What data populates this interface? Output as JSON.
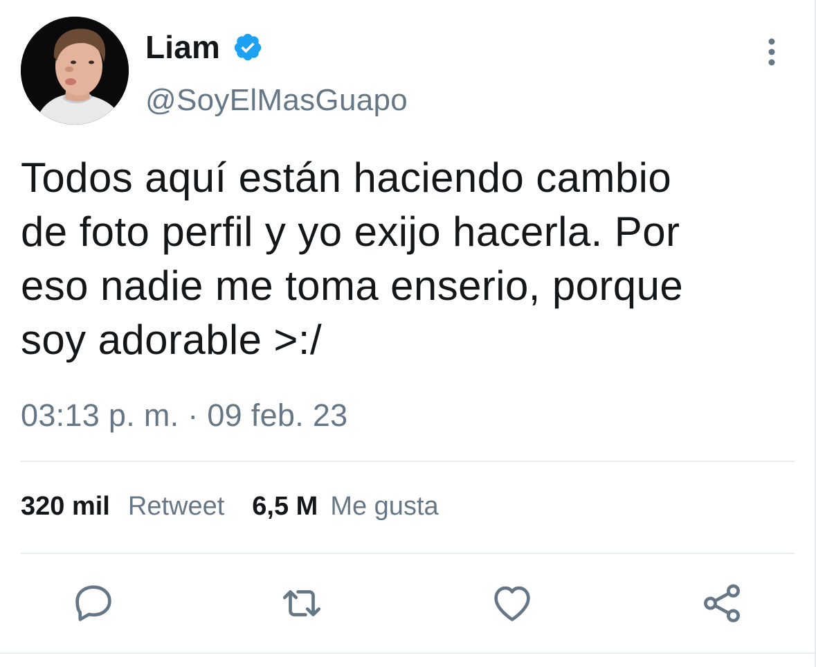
{
  "author": {
    "display_name": "Liam",
    "handle": "@SoyElMasGuapo",
    "verified": true
  },
  "tweet": {
    "text": "Todos aquí están haciendo cambio\nde foto perfil y yo exijo hacerla. Por\neso nadie me toma enserio, porque\nsoy adorable >:/",
    "timestamp": "03:13 p. m. · 09 feb. 23"
  },
  "stats": {
    "retweets_count": "320 mil",
    "retweets_label": "Retweet",
    "likes_count": "6,5 M",
    "likes_label": "Me gusta"
  },
  "icons": {
    "verified": "verified-badge-icon",
    "more": "more-options-icon",
    "reply": "reply-icon",
    "retweet": "retweet-icon",
    "like": "heart-icon",
    "share": "share-icon"
  },
  "colors": {
    "text": "#14171a",
    "secondary": "#657786",
    "verified": "#1da1f2",
    "divider": "#e6ecf0"
  }
}
